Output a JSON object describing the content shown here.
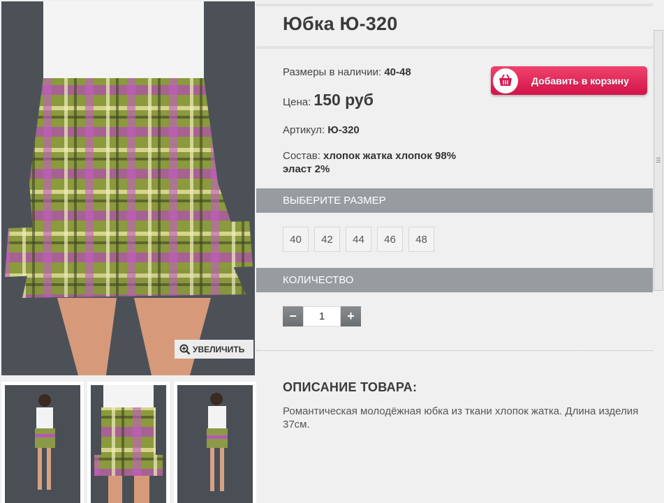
{
  "product": {
    "title": "Юбка Ю-320",
    "sizes_available_label": "Размеры в наличии:",
    "sizes_available_value": "40-48",
    "price_label": "Цена:",
    "price_value": "150 руб",
    "article_label": "Артикул:",
    "article_value": "Ю-320",
    "composition_label": "Состав:",
    "composition_value_line1": "хлопок жатка хлопок 98%",
    "composition_value_line2": "эласт 2%"
  },
  "cart": {
    "label": "Добавить в корзину",
    "icon": "basket-icon",
    "color": "#e0245a"
  },
  "zoom": {
    "label": "УВЕЛИЧИТЬ",
    "icon": "magnifier-plus-icon"
  },
  "size_section": {
    "title": "ВЫБЕРИТЕ РАЗМЕР",
    "sizes": [
      "40",
      "42",
      "44",
      "46",
      "48"
    ]
  },
  "quantity_section": {
    "title": "КОЛИЧЕСТВО",
    "minus": "−",
    "plus": "+",
    "value": "1"
  },
  "description": {
    "title": "ОПИСАНИЕ ТОВАРА:",
    "text": "Романтическая молодёжная юбка из ткани хлопок жатка. Длина изделия 37см."
  },
  "colors": {
    "section_bar": "#979ca1",
    "background": "#f0f0f0",
    "accent": "#e0245a"
  }
}
